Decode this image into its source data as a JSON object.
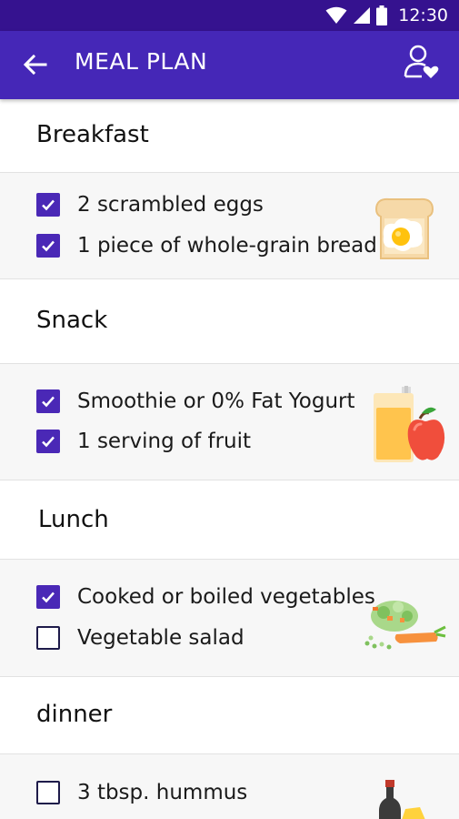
{
  "status_bar": {
    "time": "12:30"
  },
  "app_bar": {
    "title": "MEAL PLAN",
    "back_icon": "arrow-left-icon",
    "profile_icon": "user-heart-icon"
  },
  "colors": {
    "app_bar": "#4527b7",
    "status_bar": "#35128f",
    "checkbox": "#4a28b6",
    "section_body": "#f7f7f7"
  },
  "sections": [
    {
      "title": "Breakfast",
      "illustration": "toast-with-egg",
      "items": [
        {
          "label": "2 scrambled eggs",
          "checked": true
        },
        {
          "label": "1 piece of whole-grain bread",
          "checked": true
        }
      ]
    },
    {
      "title": "Snack",
      "illustration": "juice-and-apple",
      "items": [
        {
          "label": "Smoothie or 0% Fat Yogurt",
          "checked": true
        },
        {
          "label": "1 serving of fruit",
          "checked": true
        }
      ]
    },
    {
      "title": "Lunch",
      "illustration": "vegetables",
      "items": [
        {
          "label": "Cooked or boiled vegetables",
          "checked": true
        },
        {
          "label": "Vegetable salad",
          "checked": false
        }
      ]
    },
    {
      "title": "dinner",
      "illustration": "bottle-and-cheese",
      "items": [
        {
          "label": "3 tbsp. hummus",
          "checked": false
        }
      ]
    }
  ]
}
